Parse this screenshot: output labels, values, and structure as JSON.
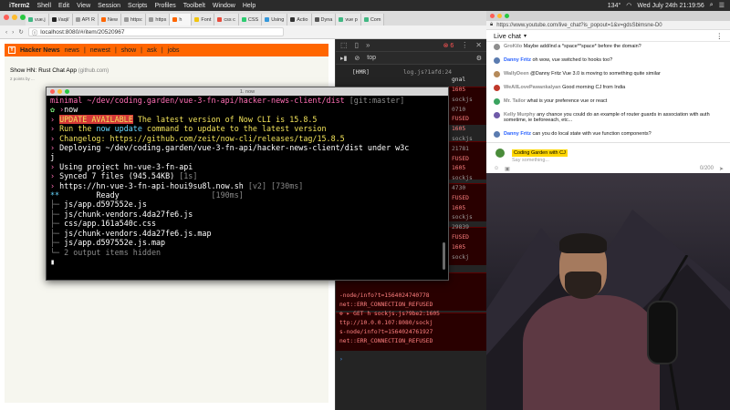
{
  "menubar": {
    "app": "iTerm2",
    "items": [
      "Shell",
      "Edit",
      "View",
      "Session",
      "Scripts",
      "Profiles",
      "Toolbelt",
      "Window",
      "Help"
    ],
    "clock": "Wed July 24th 21:19:56",
    "battery": "134°"
  },
  "browser": {
    "tabs": [
      "vue.j",
      "//aql/",
      "API R",
      "New",
      "https:",
      "https",
      "h",
      "Font",
      "css c",
      "CSS",
      "Using",
      "Actio",
      "Dyna",
      "vue p",
      "Com"
    ],
    "url": "localhost:8080/#/item/20520967"
  },
  "hn": {
    "site_name": "Hacker News",
    "nav": [
      "news",
      "newest",
      "show",
      "ask",
      "jobs"
    ],
    "item_title": "Show HN: Rust Chat App",
    "item_domain": "(github.com)",
    "item_sub": "2 points by ..."
  },
  "devtools": {
    "error_count": "6",
    "context": "top",
    "lines": [
      {
        "text": "[HMR]",
        "color": "#e0e0e0"
      },
      {
        "text": "log.js?1afd:24",
        "color": "#9a9a9a"
      },
      {
        "text": "gnal",
        "color": "#e0e0e0"
      },
      {
        "text": "1605",
        "color": "#ff8080"
      },
      {
        "text": "sockjs",
        "color": "#9a9a9a"
      },
      {
        "text": "0710",
        "color": "#9a9a9a"
      },
      {
        "text": "FUSED",
        "color": "#ff8080"
      },
      {
        "text": "1605",
        "color": "#ff8080"
      },
      {
        "text": "sockjs",
        "color": "#9a9a9a"
      },
      {
        "text": "21781",
        "color": "#9a9a9a"
      },
      {
        "text": "FUSED",
        "color": "#ff8080"
      },
      {
        "text": "1605",
        "color": "#ff8080"
      },
      {
        "text": "sockjs",
        "color": "#9a9a9a"
      },
      {
        "text": "4730",
        "color": "#9a9a9a"
      },
      {
        "text": "FUSED",
        "color": "#ff8080"
      },
      {
        "text": "1605",
        "color": "#ff8080"
      },
      {
        "text": "sockjs",
        "color": "#9a9a9a"
      },
      {
        "text": "29839",
        "color": "#9a9a9a"
      },
      {
        "text": "FUSED",
        "color": "#ff8080"
      },
      {
        "text": "1605",
        "color": "#ff8080"
      },
      {
        "text": "sockj",
        "color": "#9a9a9a"
      },
      {
        "text": "-node/info?t=1564024740778",
        "color": "#ff8080"
      },
      {
        "text": "net::ERR_CONNECTION_REFUSED",
        "color": "#ff8080"
      },
      {
        "text": "⊗ ▸ GET h sockjs.js?9be2:1605",
        "color": "#ff8080"
      },
      {
        "text": "ttp://10.0.0.107:8080/sockj",
        "color": "#ff8080"
      },
      {
        "text": "s-node/info?t=1564024761927",
        "color": "#ff8080"
      },
      {
        "text": "net::ERR_CONNECTION_REFUSED",
        "color": "#ff8080"
      }
    ]
  },
  "terminal": {
    "title": "1. now",
    "prompt_name": "minimal",
    "prompt_path": "~/dev/coding.garden/vue-3-fn-api/hacker-news-client/dist",
    "prompt_git": "[git:master]",
    "command": "now",
    "update_badge": "UPDATE AVAILABLE",
    "update_rest": " The latest version of Now CLI is 15.8.5",
    "run_line_a": "Run the ",
    "run_line_cmd": "now update",
    "run_line_b": " command to update to the latest version",
    "changelog": "Changelog: https://github.com/zeit/now-cli/releases/tag/15.8.5",
    "deploying": "Deploying ~/dev/coding.garden/vue-3-fn-api/hacker-news-client/dist under w3c",
    "deploying_wrap": "j",
    "using_project": "Using project hn-vue-3-fn-api",
    "synced": "Synced 7 files (945.54KB)",
    "synced_time": "[1s]",
    "deploy_url": "https://hn-vue-3-fn-api-houi9su8l.now.sh",
    "deploy_meta": "[v2] [730ms]",
    "ready_prefix": "**",
    "ready_label": "Ready",
    "ready_time": "[190ms]",
    "files": [
      "js/app.d597552e.js",
      "js/chunk-vendors.4da27fe6.js",
      "css/app.161a540c.css",
      "js/chunk-vendors.4da27fe6.js.map",
      "js/app.d597552e.js.map"
    ],
    "hidden": "2 output items hidden"
  },
  "chat": {
    "url": "https://www.youtube.com/live_chat?is_popout=1&v=gdsSbimsne-D0",
    "header": "Live chat",
    "messages": [
      {
        "author": "GroKilo",
        "text": "Maybe add/ind a *space**space* before the domain?",
        "avatar": "#8e8e8e",
        "owner": false
      },
      {
        "author": "Danny Fritz",
        "text": "oh wow, vue switched to hooks too?",
        "avatar": "#5a7bb0",
        "owner": true
      },
      {
        "author": "WallyDeen",
        "text": "@Danny Fritz Vue 3.0 is moving to something quite similar",
        "avatar": "#b58a5a",
        "owner": false
      },
      {
        "author": "WeAllLovePawankalyan",
        "text": "Good morning CJ from India",
        "avatar": "#c0392b",
        "owner": false
      },
      {
        "author": "Mr. Tailor",
        "text": "what is your preference vue or react",
        "avatar": "#3aa35f",
        "owner": false
      },
      {
        "author": "Kelly Murphy",
        "text": "any chance you could do an example of router guards in association with auth sometime, ie beforeeach, etc...",
        "avatar": "#6f5aa8",
        "owner": false
      },
      {
        "author": "Danny Fritz",
        "text": "can you do local state with vue function components?",
        "avatar": "#5a7bb0",
        "owner": true
      }
    ],
    "current_user": "Coding Garden with CJ",
    "placeholder": "Say something...",
    "count": "0/200"
  }
}
